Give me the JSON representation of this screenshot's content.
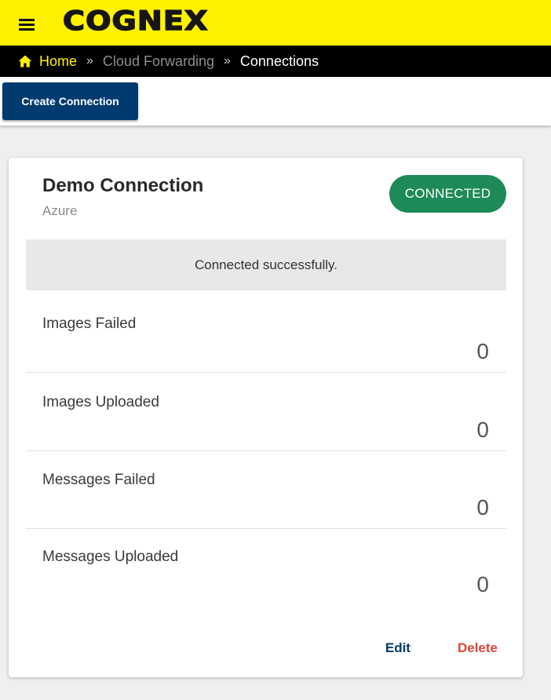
{
  "header": {
    "logo": "COGNEX",
    "menu_icon": "hamburger-menu-icon",
    "brand_color": "#fff200"
  },
  "breadcrumb": {
    "home_icon": "home-icon",
    "home": "Home",
    "separator": "»",
    "cloud": "Cloud Forwarding",
    "current": "Connections"
  },
  "toolbar": {
    "create_label": "Create Connection"
  },
  "connection": {
    "name": "Demo Connection",
    "provider": "Azure",
    "status": "CONNECTED",
    "status_color": "#1e8a57",
    "message": "Connected successfully.",
    "stats": [
      {
        "label": "Images Failed",
        "value": "0"
      },
      {
        "label": "Images Uploaded",
        "value": "0"
      },
      {
        "label": "Messages Failed",
        "value": "0"
      },
      {
        "label": "Messages Uploaded",
        "value": "0"
      }
    ],
    "edit_label": "Edit",
    "delete_label": "Delete"
  }
}
